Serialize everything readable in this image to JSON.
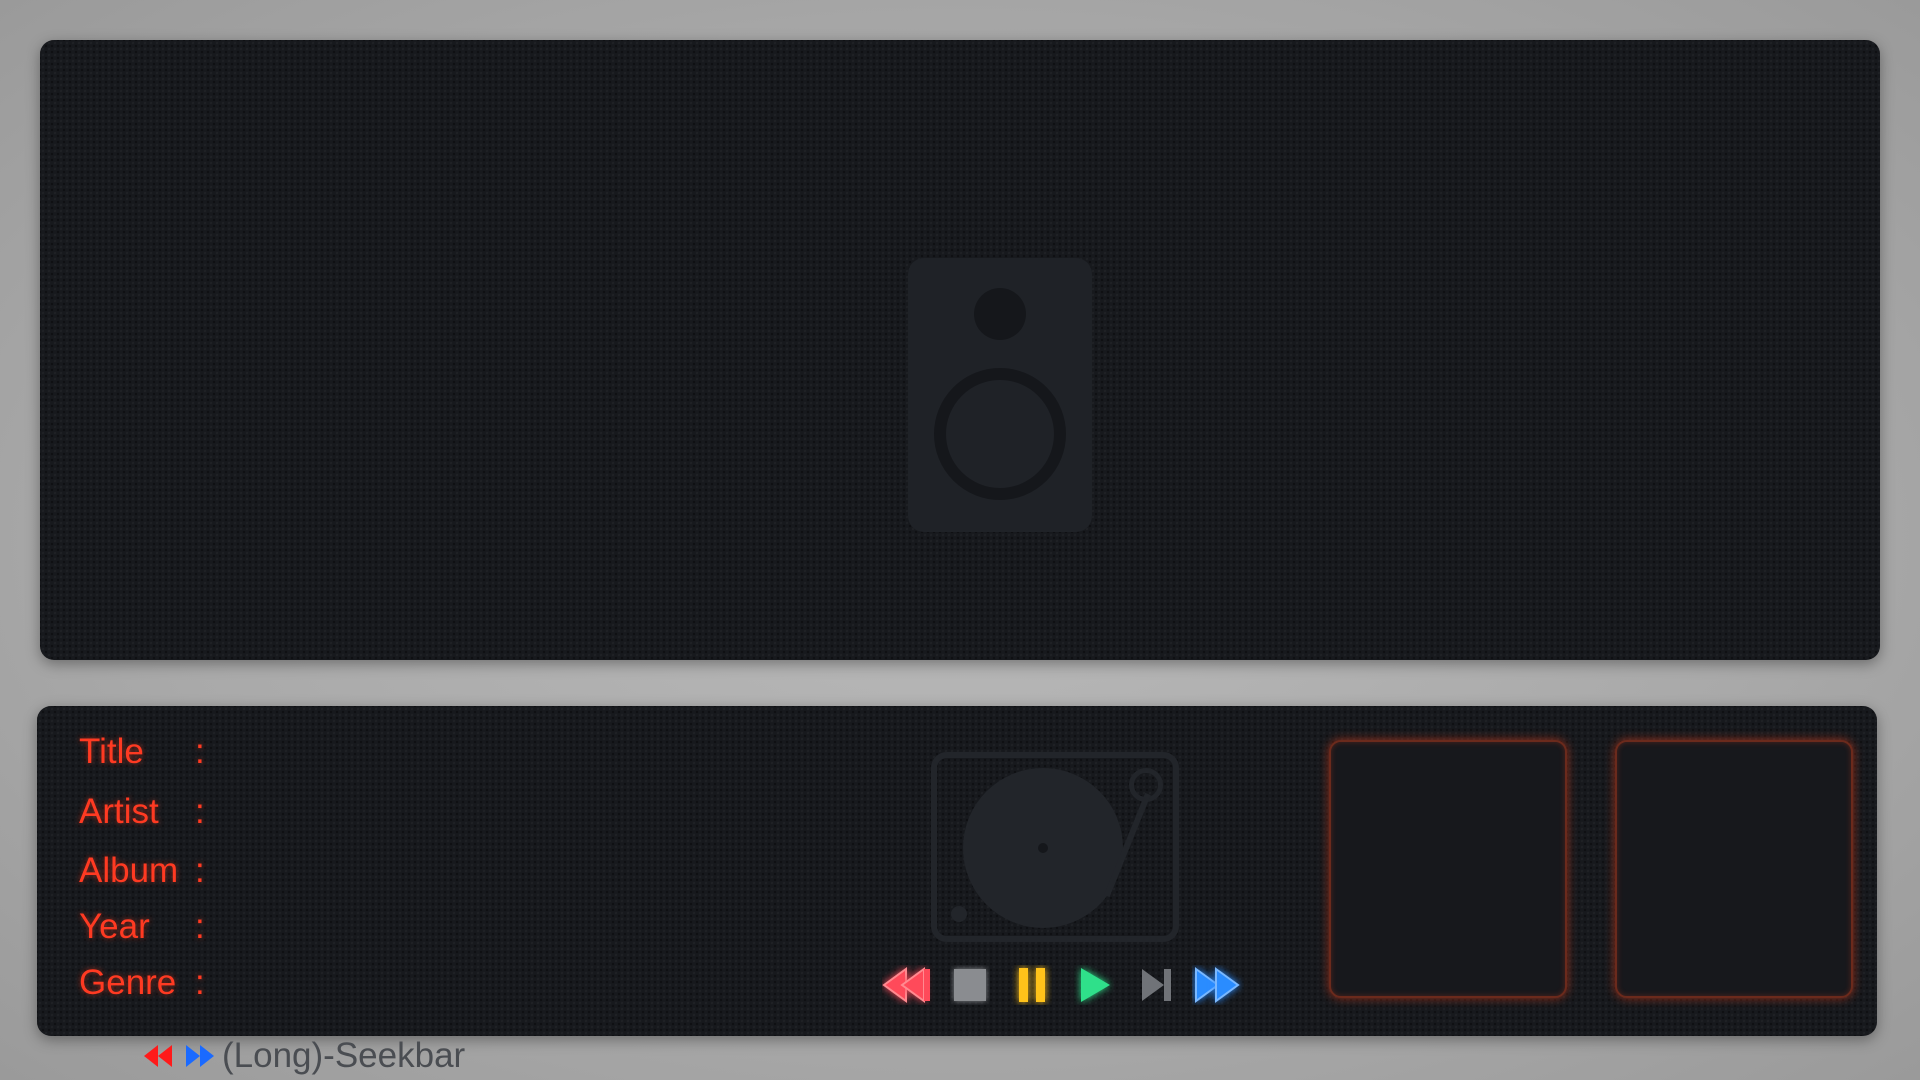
{
  "colors": {
    "label": "#ff3a22",
    "rewind": "#ff4a5a",
    "stop": "#8a8c90",
    "pause": "#ffc21a",
    "play": "#2fe08a",
    "next": "#707378",
    "fast_forward": "#2a8cff",
    "hint_rewind": "#ff1a1a",
    "hint_forward": "#1a6aff",
    "hint_text": "#4a4d52"
  },
  "metadata": [
    {
      "label": "Title",
      "colon": ":",
      "value": ""
    },
    {
      "label": "Artist",
      "colon": ":",
      "value": ""
    },
    {
      "label": "Album",
      "colon": ":",
      "value": ""
    },
    {
      "label": "Year",
      "colon": ":",
      "value": ""
    },
    {
      "label": "Genre",
      "colon": ":",
      "value": ""
    }
  ],
  "controls": [
    "rewind-icon",
    "stop-icon",
    "pause-icon",
    "play-icon",
    "next-track-icon",
    "fast-forward-icon"
  ],
  "seekbar_hint": {
    "text": "(Long)-Seekbar"
  }
}
